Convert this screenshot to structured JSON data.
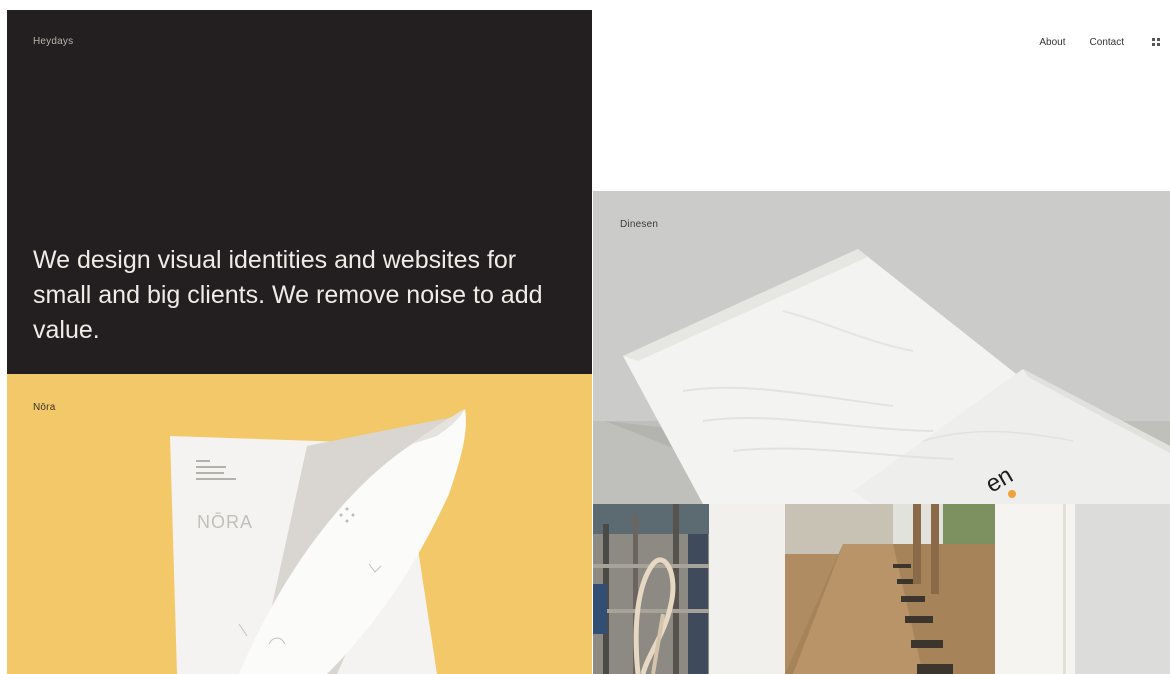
{
  "site": {
    "brand": "Heydays",
    "tagline": "We design visual identities and websites for small and big clients. We remove noise to add value."
  },
  "nav": {
    "items": [
      {
        "label": "About"
      },
      {
        "label": "Contact"
      }
    ],
    "menu_icon": "grid-icon"
  },
  "projects": [
    {
      "title": "Nōra",
      "color": "#f2c868",
      "mark_text": "NŌRA"
    },
    {
      "title": "Dinesen",
      "color": "#c9c9c7",
      "mark_text": "en"
    }
  ],
  "colors": {
    "hero_bg": "#231f20",
    "accent_orange": "#f0a13a"
  }
}
